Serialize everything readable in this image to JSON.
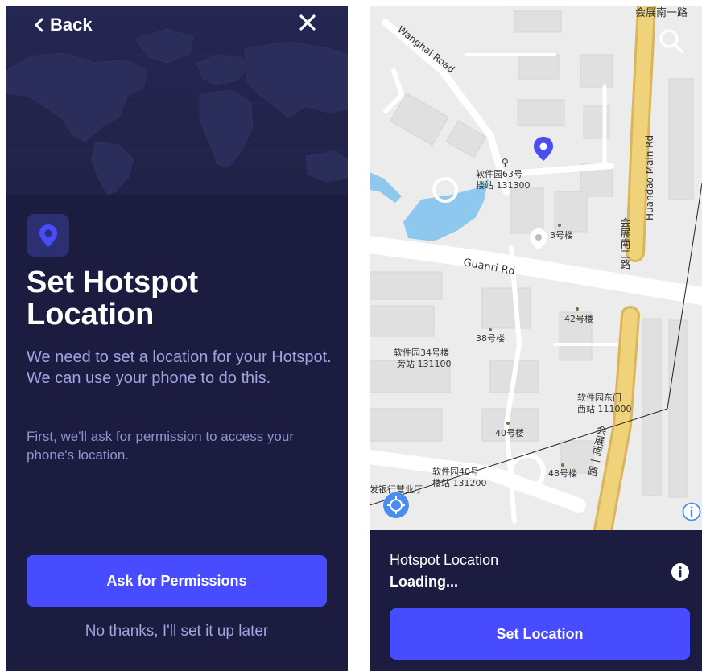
{
  "left": {
    "back_label": "Back",
    "title": "Set Hotspot Location",
    "description": "We need to set a location for your Hotspot. We can use your phone to do this.",
    "note": "First, we'll ask for permission to access your phone's location.",
    "primary_button": "Ask for Permissions",
    "secondary_link": "No thanks, I'll set it up later"
  },
  "map": {
    "labels": {
      "wanghai_road": "Wanghai Road",
      "guanri_rd": "Guanri Rd",
      "huandao_main_rd": "Huandao Main Rd",
      "huizhan_top": "会展南一路",
      "huizhan_mid": "会展南二路",
      "huizhan_bottom": "会展南一路",
      "station_63": "软件园63号",
      "station_63_id": "楼站 131300",
      "building_3": "3号楼",
      "building_42": "42号楼",
      "building_38": "38号楼",
      "station_34": "软件园34号楼",
      "station_34_id": "旁站 131100",
      "station_east": "软件园东门",
      "station_east_id": "西站 111000",
      "building_40": "40号楼",
      "station_40": "软件园40号",
      "station_40_id": "楼站 131200",
      "building_48": "48号楼",
      "bank": "发银行营业厅"
    }
  },
  "bottom": {
    "label": "Hotspot Location",
    "status": "Loading...",
    "button": "Set Location"
  },
  "colors": {
    "panel_bg": "#1b1c3f",
    "accent": "#474dff",
    "muted_text": "#9ea5df",
    "marker_blue": "#4a4df0",
    "road_yellow": "#e9c96a",
    "water": "#8ec8ee"
  }
}
